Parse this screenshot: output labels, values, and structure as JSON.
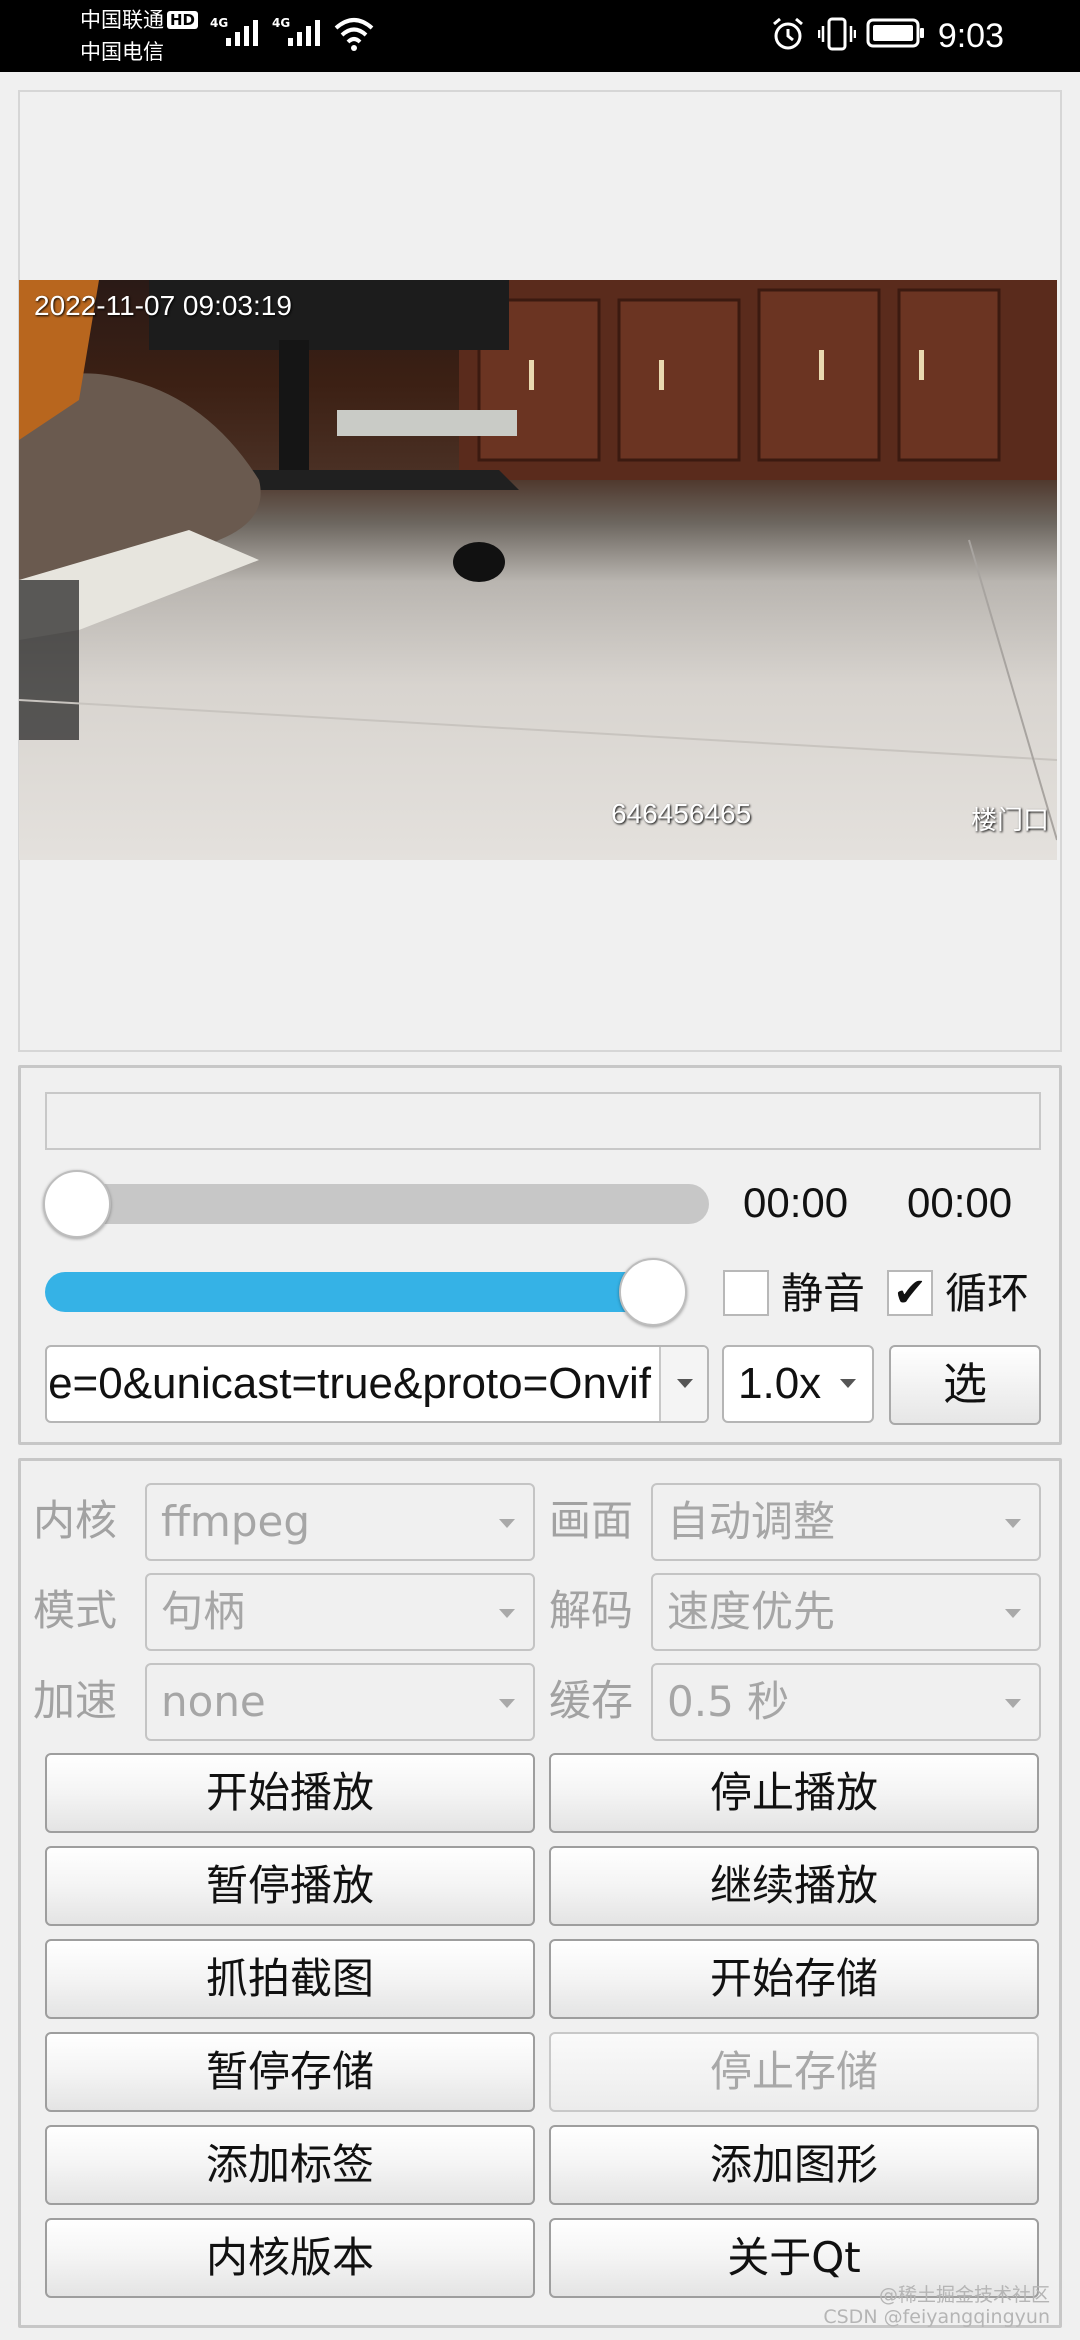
{
  "status_bar": {
    "carrier_1": "中国联通",
    "hd_badge": "HD",
    "carrier_2": "中国电信",
    "network_1": "4G",
    "network_2": "4G",
    "time": "9:03",
    "icons": [
      "signal-icon",
      "signal-icon",
      "wifi-icon",
      "alarm-icon",
      "vibrate-icon",
      "battery-icon"
    ]
  },
  "video": {
    "osd_timestamp": "2022-11-07 09:03:19",
    "osd_id": "646456465",
    "osd_location": "楼门口"
  },
  "controls": {
    "progress": 0.0,
    "time_current": "00:00",
    "time_total": "00:00",
    "volume": 1.0,
    "mute_label": "静音",
    "mute_checked": false,
    "loop_label": "循环",
    "loop_checked": true,
    "url_value": "e=0&unicast=true&proto=Onvif",
    "speed_value": "1.0x",
    "select_label": "选"
  },
  "settings": {
    "kernel_label": "内核",
    "kernel_value": "ffmpeg",
    "screen_label": "画面",
    "screen_value": "自动调整",
    "mode_label": "模式",
    "mode_value": "句柄",
    "decode_label": "解码",
    "decode_value": "速度优先",
    "accel_label": "加速",
    "accel_value": "none",
    "cache_label": "缓存",
    "cache_value": "0.5 秒"
  },
  "buttons": {
    "start_play": "开始播放",
    "stop_play": "停止播放",
    "pause_play": "暂停播放",
    "resume_play": "继续播放",
    "snapshot": "抓拍截图",
    "start_record": "开始存储",
    "pause_record": "暂停存储",
    "stop_record": "停止存储",
    "add_label": "添加标签",
    "add_shape": "添加图形",
    "kernel_version": "内核版本",
    "about_qt": "关于Qt"
  },
  "watermark": {
    "line1": "@稀土掘金技术社区",
    "line2": "CSDN @feiyangqingyun"
  },
  "colors": {
    "volume_fill": "#35b2e6",
    "status_bar_bg": "#000000",
    "panel_bg": "#f0f0f0"
  }
}
